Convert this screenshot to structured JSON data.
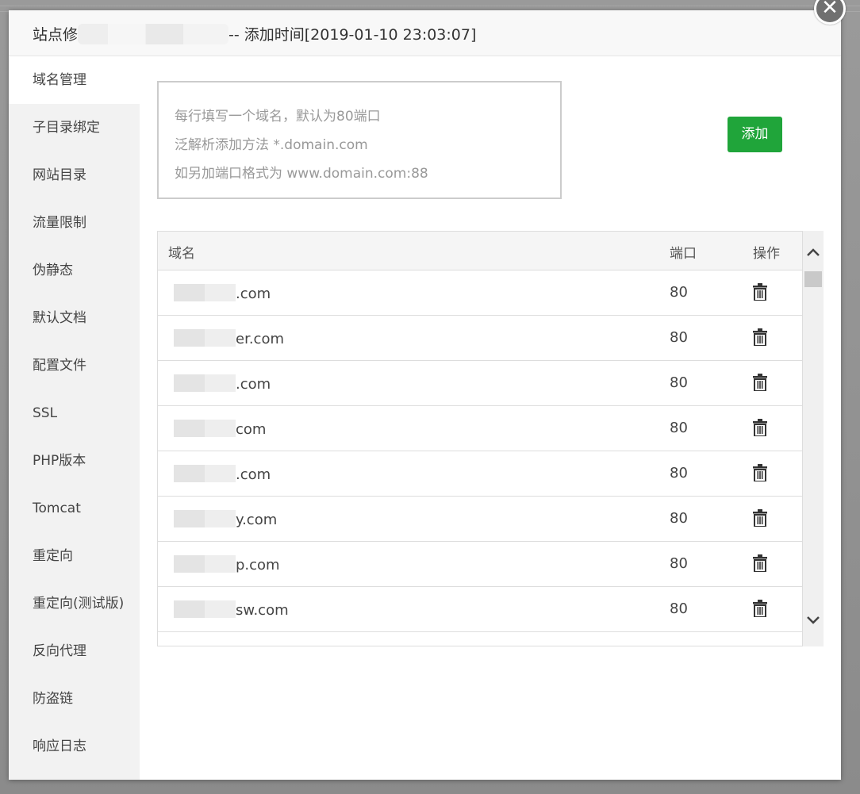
{
  "dialog": {
    "title_prefix": "站点修",
    "title_suffix": "-- 添加时间[2019-01-10 23:03:07]"
  },
  "sidebar": {
    "items": [
      {
        "label": "域名管理"
      },
      {
        "label": "子目录绑定"
      },
      {
        "label": "网站目录"
      },
      {
        "label": "流量限制"
      },
      {
        "label": "伪静态"
      },
      {
        "label": "默认文档"
      },
      {
        "label": "配置文件"
      },
      {
        "label": "SSL"
      },
      {
        "label": "PHP版本"
      },
      {
        "label": "Tomcat"
      },
      {
        "label": "重定向"
      },
      {
        "label": "重定向(测试版)"
      },
      {
        "label": "反向代理"
      },
      {
        "label": "防盗链"
      },
      {
        "label": "响应日志"
      }
    ]
  },
  "domain_input": {
    "placeholder_lines": [
      "每行填写一个域名，默认为80端口",
      "泛解析添加方法 *.domain.com",
      "如另加端口格式为 www.domain.com:88"
    ],
    "add_label": "添加"
  },
  "table": {
    "columns": {
      "domain": "域名",
      "port": "端口",
      "action": "操作"
    },
    "rows": [
      {
        "domain_visible": ".com",
        "port": "80"
      },
      {
        "domain_visible": "er.com",
        "port": "80"
      },
      {
        "domain_visible": ".com",
        "port": "80"
      },
      {
        "domain_visible": "com",
        "port": "80"
      },
      {
        "domain_visible": ".com",
        "port": "80"
      },
      {
        "domain_visible": "y.com",
        "port": "80"
      },
      {
        "domain_visible": "p.com",
        "port": "80"
      },
      {
        "domain_visible": "sw.com",
        "port": "80"
      }
    ]
  },
  "icons": {
    "close": "close-icon",
    "delete": "trash-icon",
    "scroll_up": "chevron-up-icon",
    "scroll_down": "chevron-down-icon"
  },
  "colors": {
    "primary_green": "#20a53a",
    "sidebar_bg": "#f2f2f2",
    "header_bg": "#f8f8f8"
  }
}
